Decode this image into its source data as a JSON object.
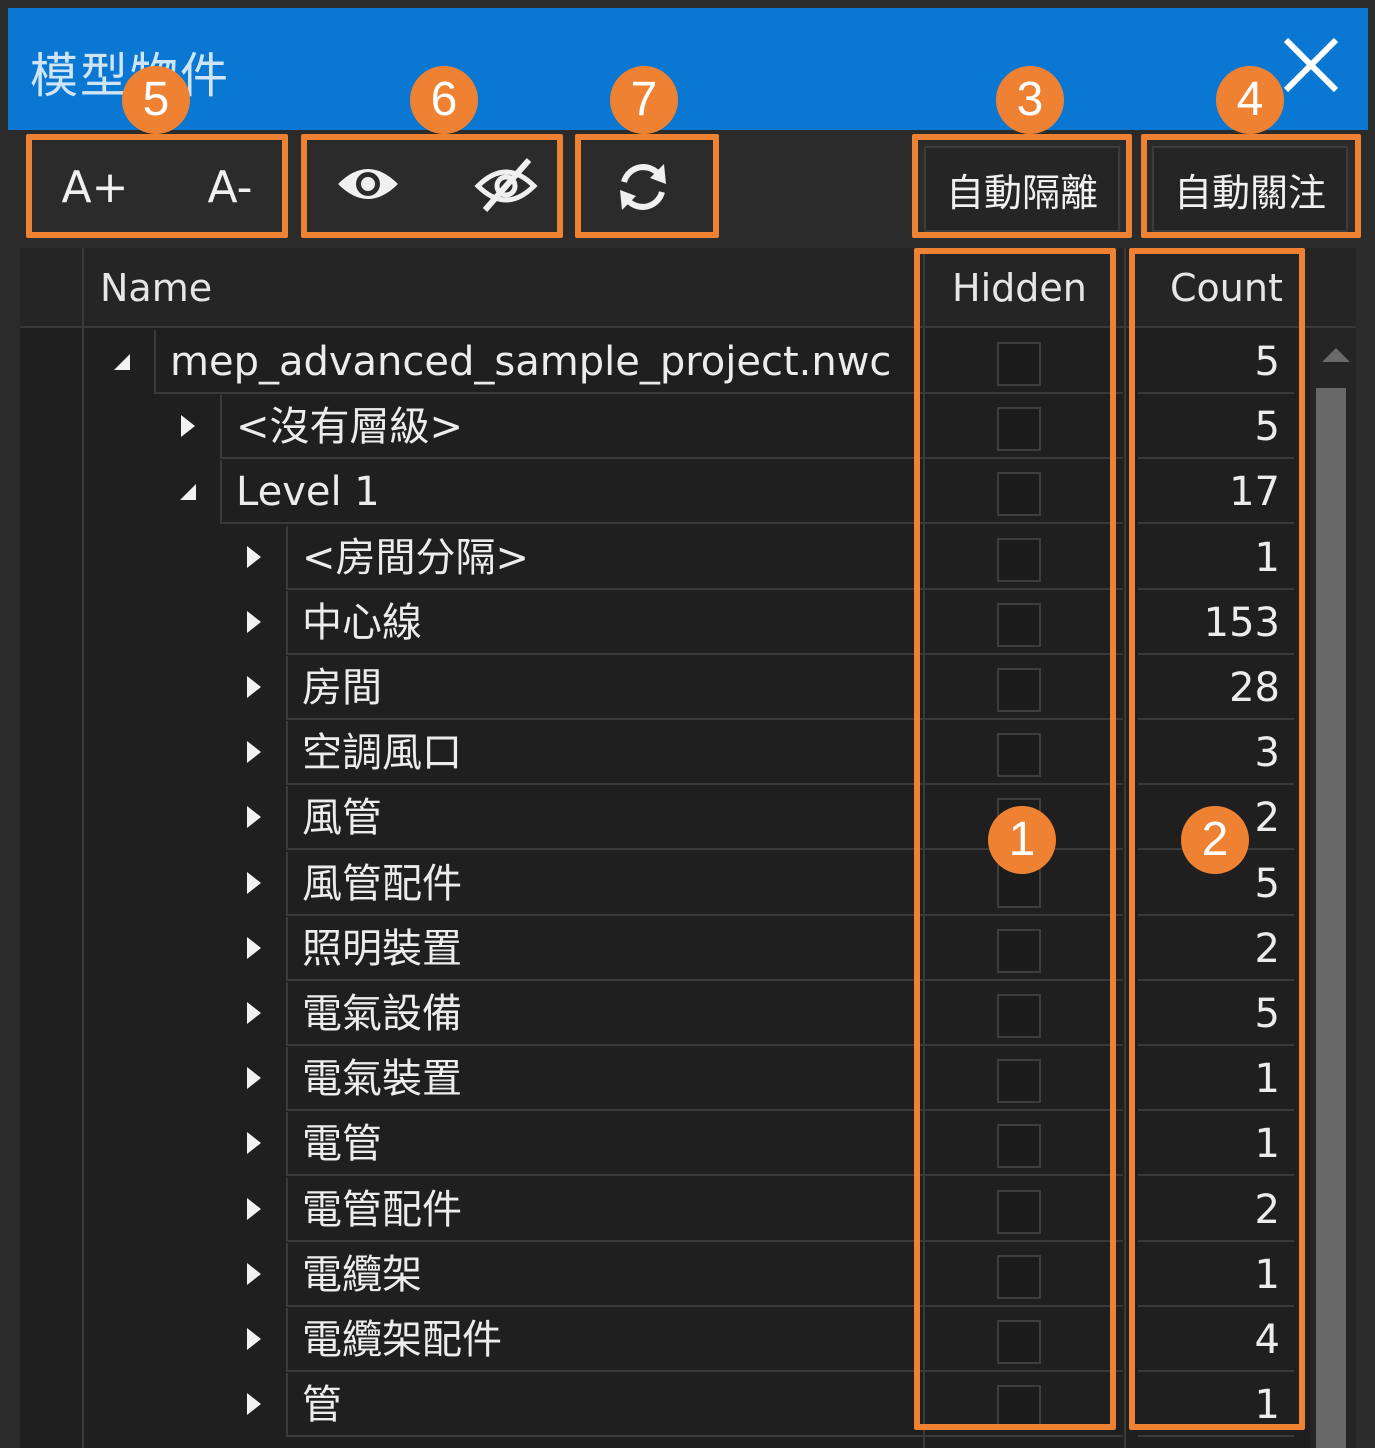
{
  "window": {
    "title": "模型物件"
  },
  "toolbar": {
    "font_increase": "A+",
    "font_decrease": "A-",
    "auto_isolate": "自動隔離",
    "auto_focus": "自動關注"
  },
  "columns": {
    "name": "Name",
    "hidden": "Hidden",
    "count": "Count"
  },
  "rows": [
    {
      "name": "mep_advanced_sample_project.nwc",
      "count": "5",
      "expanded": true,
      "depth": 0
    },
    {
      "name": "<沒有層級>",
      "count": "5",
      "expanded": false,
      "depth": 1
    },
    {
      "name": "Level 1",
      "count": "17",
      "expanded": true,
      "depth": 1
    },
    {
      "name": "<房間分隔>",
      "count": "1",
      "expanded": false,
      "depth": 2
    },
    {
      "name": "中心線",
      "count": "153",
      "expanded": false,
      "depth": 2
    },
    {
      "name": "房間",
      "count": "28",
      "expanded": false,
      "depth": 2
    },
    {
      "name": "空調風口",
      "count": "3",
      "expanded": false,
      "depth": 2
    },
    {
      "name": "風管",
      "count": "2",
      "expanded": false,
      "depth": 2
    },
    {
      "name": "風管配件",
      "count": "5",
      "expanded": false,
      "depth": 2
    },
    {
      "name": "照明裝置",
      "count": "2",
      "expanded": false,
      "depth": 2
    },
    {
      "name": "電氣設備",
      "count": "5",
      "expanded": false,
      "depth": 2
    },
    {
      "name": "電氣裝置",
      "count": "1",
      "expanded": false,
      "depth": 2
    },
    {
      "name": "電管",
      "count": "1",
      "expanded": false,
      "depth": 2
    },
    {
      "name": "電管配件",
      "count": "2",
      "expanded": false,
      "depth": 2
    },
    {
      "name": "電纜架",
      "count": "1",
      "expanded": false,
      "depth": 2
    },
    {
      "name": "電纜架配件",
      "count": "4",
      "expanded": false,
      "depth": 2
    },
    {
      "name": "管",
      "count": "1",
      "expanded": false,
      "depth": 2
    }
  ],
  "annotations": [
    "1",
    "2",
    "3",
    "4",
    "5",
    "6",
    "7"
  ],
  "colors": {
    "accent": "#ee8232",
    "titlebar": "#0a78d2",
    "background": "#1f1f1f"
  },
  "icons": [
    "close-icon",
    "eye-icon",
    "eye-off-icon",
    "refresh-icon",
    "expand-arrow-icon",
    "collapse-arrow-icon"
  ]
}
